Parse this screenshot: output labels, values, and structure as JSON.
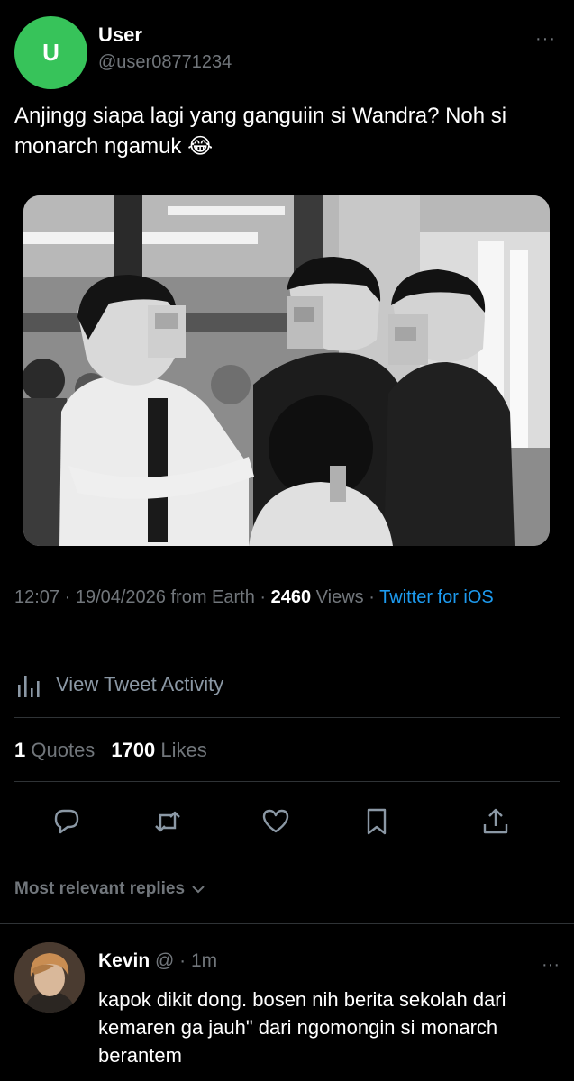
{
  "tweet": {
    "avatar_letter": "U",
    "avatar_color": "#37c35a",
    "display_name": "User",
    "handle": "@user08771234",
    "more": "···",
    "text": "Anjingg siapa lagi yang ganguiin si Wandra? Noh si monarch ngamuk 😂",
    "meta": {
      "time_date": "12:07 · 19/04/2026 from Earth · ",
      "views_count": "2460",
      "views_label": " Views · ",
      "client": "Twitter for iOS"
    }
  },
  "activity": {
    "label": "View Tweet Activity",
    "icon": "bar-chart-icon"
  },
  "stats": {
    "quotes_count": "1",
    "quotes_label": "Quotes",
    "likes_count": "1700",
    "likes_label": "Likes"
  },
  "actions": [
    "reply-icon",
    "retweet-icon",
    "like-icon",
    "bookmark-icon",
    "share-icon"
  ],
  "replies": {
    "header": "Most relevant replies",
    "items": [
      {
        "name": "Kevin",
        "meta": " @ · 1m",
        "more": "···",
        "text": "kapok dikit dong. bosen nih berita sekolah dari kemaren ga jauh\" dari ngomongin si monarch berantem"
      }
    ]
  },
  "colors": {
    "background": "#000000",
    "muted": "#71767b",
    "link": "#1d9bf0",
    "divider": "#2f3336"
  }
}
